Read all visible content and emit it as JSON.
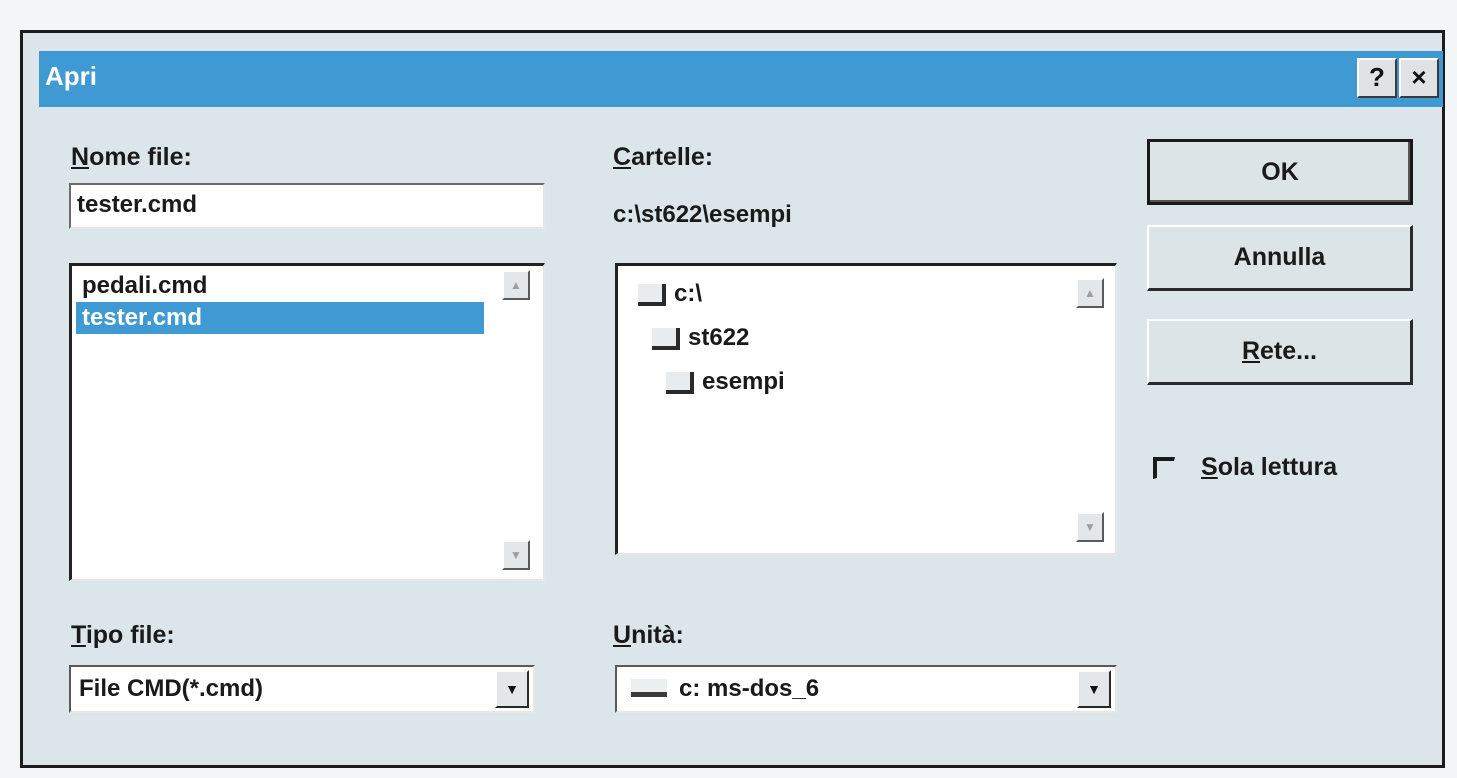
{
  "title_bar": {
    "title": "Apri",
    "help_button": "?",
    "close_button": "×"
  },
  "file_name": {
    "label_accel": "N",
    "label_rest": "ome file:",
    "value": "tester.cmd",
    "files": [
      {
        "name": "pedali.cmd",
        "selected": false
      },
      {
        "name": "tester.cmd",
        "selected": true
      }
    ]
  },
  "folders": {
    "label_accel": "C",
    "label_rest": "artelle:",
    "current_path": "c:\\st622\\esempi",
    "tree": [
      {
        "name": "c:\\",
        "level": 0
      },
      {
        "name": "st622",
        "level": 1
      },
      {
        "name": "esempi",
        "level": 2
      }
    ]
  },
  "file_type": {
    "label_accel": "T",
    "label_rest": "ipo file:",
    "selected": "File CMD(*.cmd)",
    "dropdown_icon": "arrow-down"
  },
  "drives": {
    "label_accel": "U",
    "label_rest": "nità:",
    "selected": "c: ms-dos_6",
    "dropdown_icon": "arrow-down"
  },
  "buttons": {
    "ok": "OK",
    "cancel": "Annulla",
    "network_accel": "R",
    "network_rest": "ete..."
  },
  "read_only": {
    "label_accel": "S",
    "label_rest": "ola lettura",
    "checked": false
  },
  "colors": {
    "title_bar": "#3f9ad4",
    "selection": "#3f9ad4",
    "dialog_bg": "#dce6ea"
  }
}
